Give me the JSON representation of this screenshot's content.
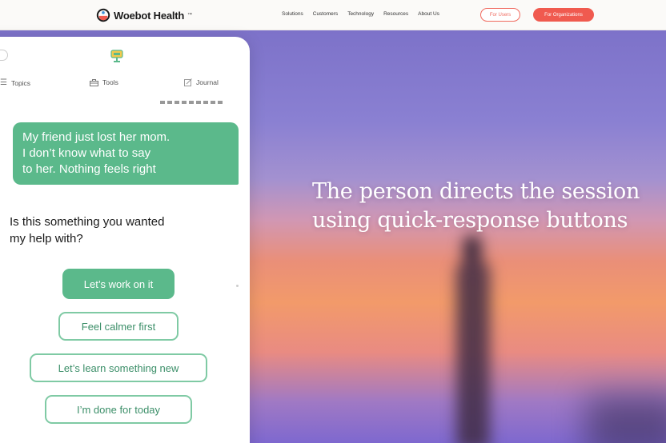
{
  "header": {
    "brand": "Woebot Health",
    "brand_tm": "™",
    "nav": [
      "Solutions",
      "Customers",
      "Technology",
      "Resources",
      "About Us"
    ],
    "for_users_label": "For Users",
    "for_orgs_label": "For Organizations"
  },
  "colors": {
    "accent_green": "#5bb98b",
    "cta_red": "#f05a4f"
  },
  "hero": {
    "headline_line1": "The person directs the session",
    "headline_line2": "using quick-response buttons"
  },
  "chat": {
    "tabs": [
      {
        "label": "Topics",
        "icon": "list-icon"
      },
      {
        "label": "Tools",
        "icon": "toolbox-icon"
      },
      {
        "label": "Journal",
        "icon": "edit-icon"
      }
    ],
    "user_message_line1": "My friend just lost her mom.",
    "user_message_line2": "I don’t know what to say",
    "user_message_line3": "to her. Nothing feels right",
    "bot_message_line1": "Is this something you wanted",
    "bot_message_line2": "my help with?",
    "quick_replies": [
      "Let’s work on it",
      "Feel calmer first",
      "Let’s learn something new",
      "I’m done for today"
    ]
  }
}
